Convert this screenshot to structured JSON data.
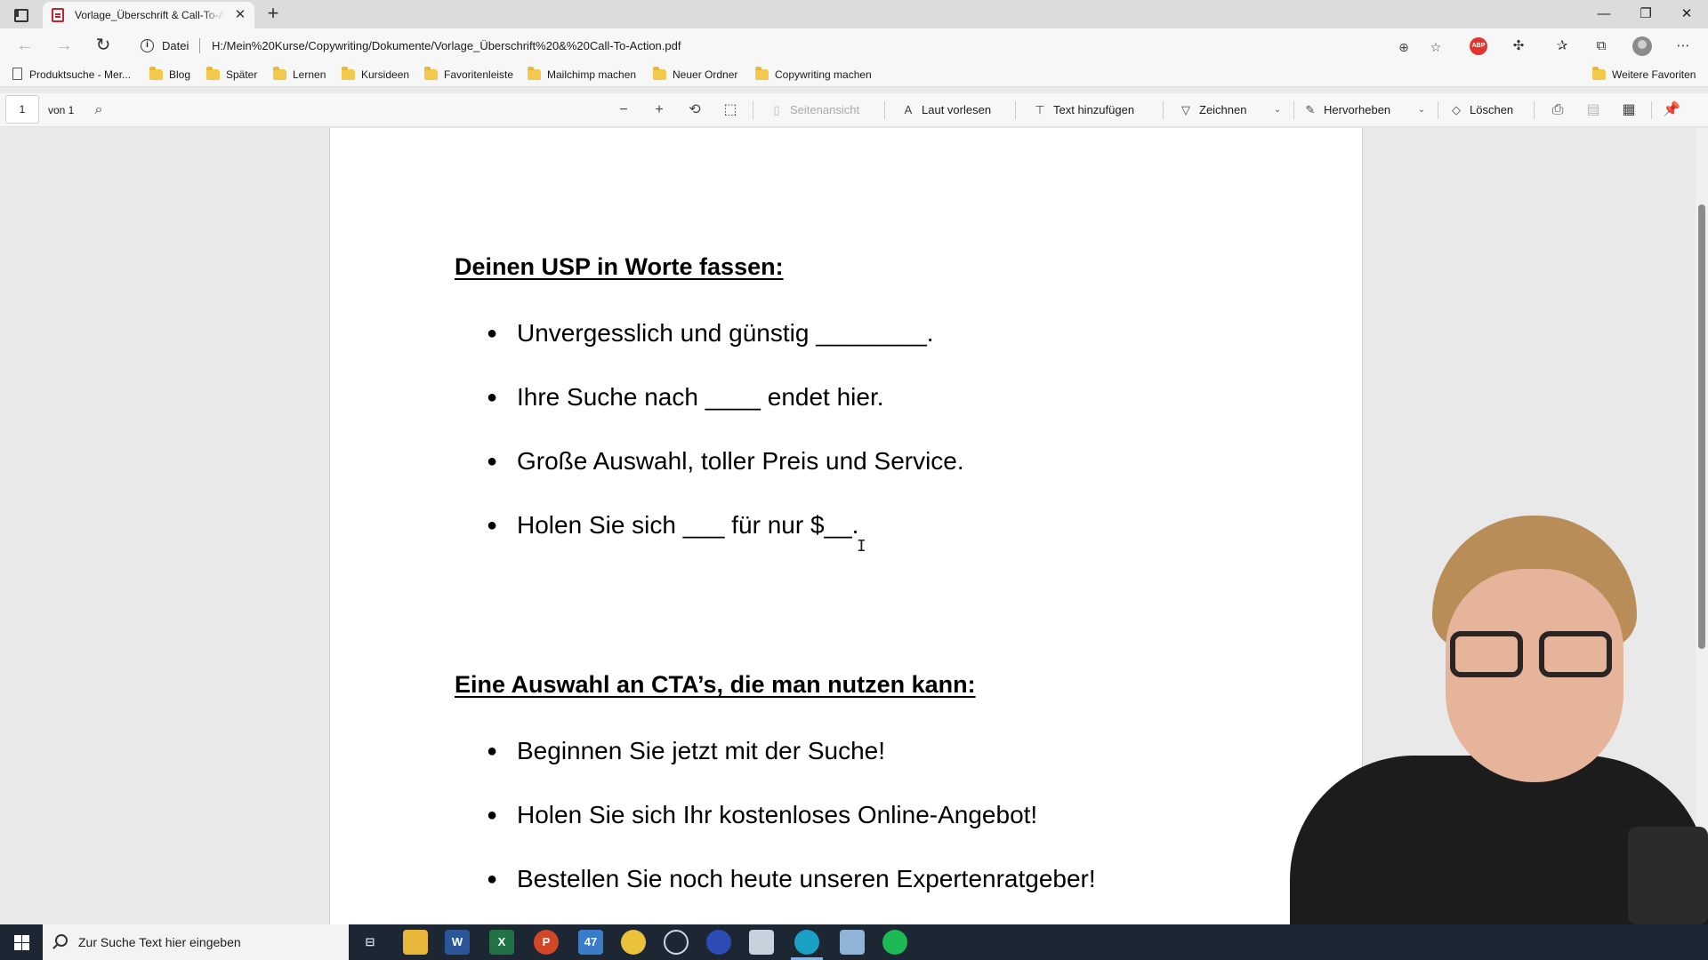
{
  "browser": {
    "tab": {
      "title": "Vorlage_Überschrift & Call-To-Action.pdf",
      "close": "✕"
    },
    "new_tab": "+",
    "window_controls": {
      "minimize": "—",
      "restore": "❐",
      "close": "✕"
    },
    "nav": {
      "back": "←",
      "forward": "→",
      "reload": "↻"
    },
    "address": {
      "site_label": "Datei",
      "url": "H:/Mein%20Kurse/Copywriting/Dokumente/Vorlage_Überschrift%20&%20Call-To-Action.pdf"
    },
    "toolbar_icons": [
      "zoom-icon",
      "favorite-add-icon",
      "adblock-icon",
      "extensions-icon",
      "favorites-icon",
      "collections-icon",
      "profile-icon",
      "more-icon"
    ],
    "adblock_label": "ABP"
  },
  "bookmarks": {
    "items": [
      {
        "label": "Produktsuche - Mer...",
        "type": "page"
      },
      {
        "label": "Blog",
        "type": "folder"
      },
      {
        "label": "Später",
        "type": "folder"
      },
      {
        "label": "Lernen",
        "type": "folder"
      },
      {
        "label": "Kursideen",
        "type": "folder"
      },
      {
        "label": "Favoritenleiste",
        "type": "folder"
      },
      {
        "label": "Mailchimp machen",
        "type": "folder"
      },
      {
        "label": "Neuer Ordner",
        "type": "folder"
      },
      {
        "label": "Copywriting machen",
        "type": "folder"
      }
    ],
    "other": "Weitere Favoriten"
  },
  "pdf_toolbar": {
    "page_number": "1",
    "page_count_label": "von 1",
    "page_view": "Seitenansicht",
    "read_aloud": "Laut vorlesen",
    "add_text": "Text hinzufügen",
    "draw": "Zeichnen",
    "highlight": "Hervorheben",
    "erase": "Löschen"
  },
  "document": {
    "section1": {
      "heading": "Deinen USP in Worte fassen:",
      "items": [
        "Unvergesslich und günstig ________.",
        "Ihre Suche nach ____ endet hier.",
        "Große Auswahl, toller Preis und Service.",
        "Holen Sie sich ___ für nur $__."
      ]
    },
    "section2": {
      "heading": "Eine Auswahl an CTA’s, die man nutzen kann:",
      "items": [
        "Beginnen Sie jetzt mit der Suche!",
        "Holen Sie sich Ihr kostenloses Online-Angebot!",
        "Bestellen Sie noch heute unseren Expertenratgeber!"
      ]
    }
  },
  "taskbar": {
    "search_placeholder": "Zur Suche Text hier eingeben",
    "mail_badge": "47",
    "apps": [
      "task-view",
      "file-explorer",
      "word",
      "excel",
      "powerpoint",
      "mail",
      "chrome",
      "obs",
      "app-blue",
      "app-image",
      "edge",
      "notepad",
      "spotify"
    ]
  },
  "colors": {
    "accent_active": "#7fb4ef",
    "pdf_red": "#c0262d",
    "folder_yellow": "#f2c94c",
    "taskbar": "#1d2734"
  }
}
